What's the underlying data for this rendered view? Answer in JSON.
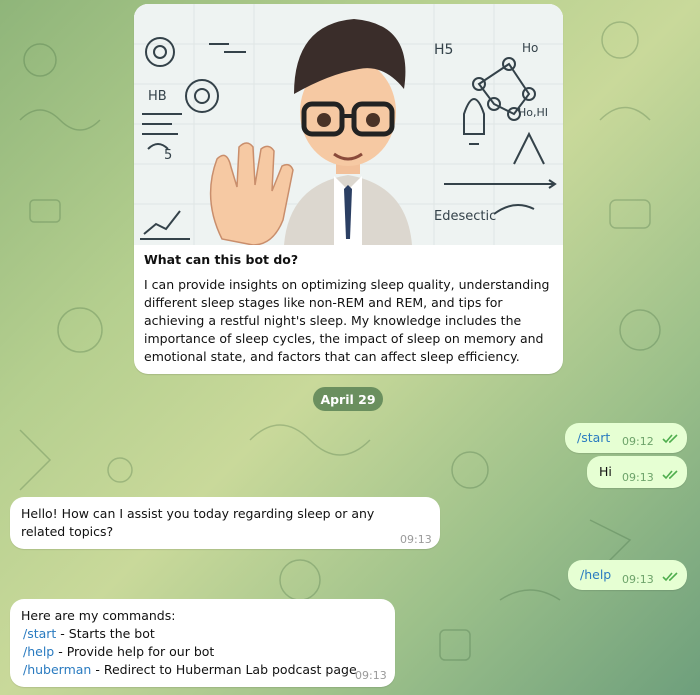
{
  "intro": {
    "title": "What can this bot do?",
    "text": "I can provide insights on optimizing sleep quality, understanding different sleep stages like non-REM and REM, and tips for achieving a restful night's sleep. My knowledge includes the importance of sleep cycles, the impact of sleep on memory and emotional state, and factors that can affect sleep efficiency.",
    "image_labels": [
      "HB",
      "H5",
      "Ho",
      "Ho,HI",
      "5",
      "Edesectic"
    ]
  },
  "date_separator": "April 29",
  "messages": [
    {
      "direction": "out",
      "text": "/start",
      "time": "09:12",
      "is_command": true
    },
    {
      "direction": "out",
      "text": "Hi",
      "time": "09:13"
    },
    {
      "direction": "in",
      "text": "Hello! How can I assist you today regarding sleep or any related topics?",
      "time": "09:13"
    },
    {
      "direction": "out",
      "text": "/help",
      "time": "09:13",
      "is_command": true
    },
    {
      "direction": "in",
      "time": "09:13",
      "header": "Here are my commands:",
      "commands": [
        {
          "cmd": "/start",
          "desc": " - Starts the bot"
        },
        {
          "cmd": "/help",
          "desc": " - Provide help for our bot"
        },
        {
          "cmd": "/huberman",
          "desc": " - Redirect to Huberman Lab podcast page"
        }
      ]
    }
  ],
  "colors": {
    "outgoing_bubble": "#e6ffd3",
    "incoming_bubble": "#ffffff",
    "command_link": "#2a7bc0",
    "read_ticks": "#4fae4e"
  },
  "icons": [
    "double-check-icon"
  ]
}
